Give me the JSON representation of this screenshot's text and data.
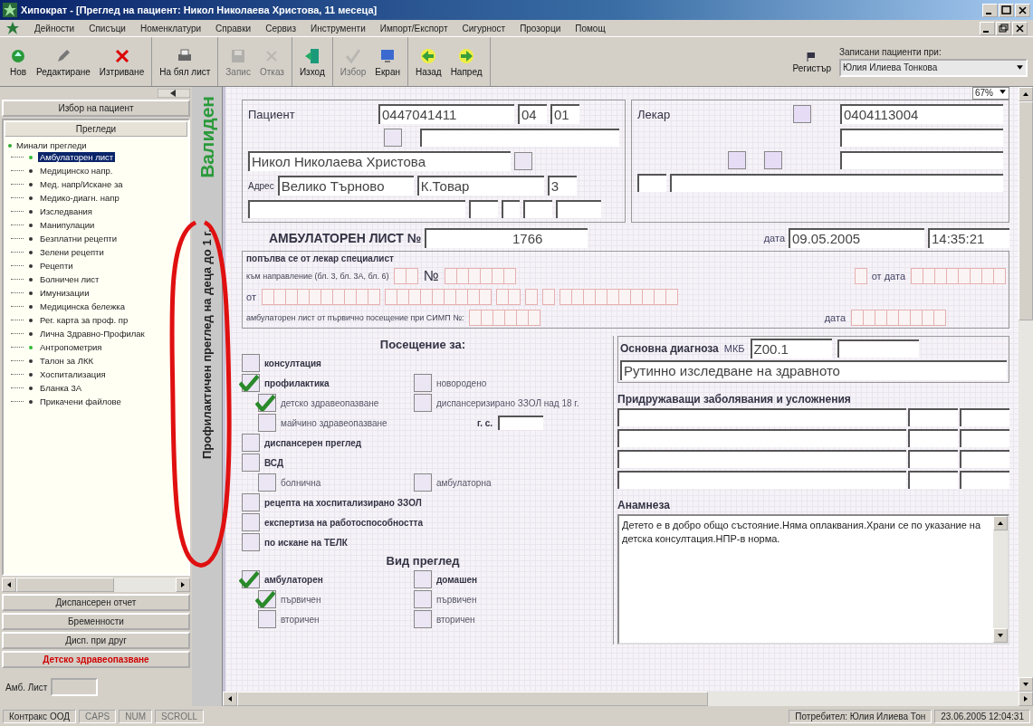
{
  "window": {
    "title": "Хипократ - [Преглед на пациент: Никол Николаева Христова, 11 месеца]"
  },
  "menu": [
    "Дейности",
    "Списъци",
    "Номенклатури",
    "Справки",
    "Сервиз",
    "Инструменти",
    "Импорт/Експорт",
    "Сигурност",
    "Прозорци",
    "Помощ"
  ],
  "toolbar": {
    "groups": [
      {
        "buttons": [
          {
            "label": "Нов",
            "disabled": false
          },
          {
            "label": "Редактиране",
            "disabled": false
          },
          {
            "label": "Изтриване",
            "disabled": false
          }
        ]
      },
      {
        "buttons": [
          {
            "label": "На бял лист",
            "disabled": false
          }
        ]
      },
      {
        "buttons": [
          {
            "label": "Запис",
            "disabled": true
          },
          {
            "label": "Отказ",
            "disabled": true
          }
        ]
      },
      {
        "buttons": [
          {
            "label": "Изход",
            "disabled": false
          }
        ]
      },
      {
        "buttons": [
          {
            "label": "Избор",
            "disabled": true
          },
          {
            "label": "Екран",
            "disabled": false
          }
        ]
      },
      {
        "buttons": [
          {
            "label": "Назад",
            "disabled": false
          },
          {
            "label": "Напред",
            "disabled": false
          }
        ]
      }
    ],
    "register": "Регистър",
    "patients_label": "Записани пациенти при:",
    "patients_value": "Юлия Илиева Тонкова"
  },
  "sidebar": {
    "patient_button": "Избор на пациент",
    "section": "Прегледи",
    "tree": [
      {
        "label": "Минали прегледи",
        "expanded": true,
        "children": [
          {
            "label": "Амбулаторен лист",
            "selected": true,
            "marked": true
          },
          {
            "label": "Медицинско напр.",
            "selected": false,
            "marked": false
          },
          {
            "label": "Мед. напр/Искане за",
            "selected": false,
            "marked": false
          },
          {
            "label": "Медико-диагн. напр",
            "selected": false,
            "marked": false
          },
          {
            "label": "Изследвания",
            "selected": false,
            "marked": false
          },
          {
            "label": "Манипулации",
            "selected": false,
            "marked": false
          },
          {
            "label": "Безплатни рецепти",
            "selected": false,
            "marked": false
          },
          {
            "label": "Зелени рецепти",
            "selected": false,
            "marked": false
          },
          {
            "label": "Рецепти",
            "selected": false,
            "marked": false
          },
          {
            "label": "Болничен лист",
            "selected": false,
            "marked": false
          },
          {
            "label": "Имунизации",
            "selected": false,
            "marked": false
          },
          {
            "label": "Медицинска бележка",
            "selected": false,
            "marked": false
          },
          {
            "label": "Рег. карта за проф. пр",
            "selected": false,
            "marked": false
          },
          {
            "label": "Лична Здравно-Профилак",
            "selected": false,
            "marked": false
          },
          {
            "label": "Антропометрия",
            "selected": false,
            "marked": true
          },
          {
            "label": "Талон за ЛКК",
            "selected": false,
            "marked": false
          },
          {
            "label": "Хоспитализация",
            "selected": false,
            "marked": false
          },
          {
            "label": "Бланка 3А",
            "selected": false,
            "marked": false
          },
          {
            "label": "Прикачени файлове",
            "selected": false,
            "marked": false
          }
        ]
      }
    ],
    "buttons": [
      {
        "label": "Диспансерен отчет",
        "selected": false
      },
      {
        "label": "Бременности",
        "selected": false
      },
      {
        "label": "Дисп. при друг",
        "selected": false
      },
      {
        "label": "Детско здравеопазване",
        "selected": true
      }
    ],
    "amb_label": "Амб. Лист"
  },
  "side_tab": {
    "status": "Валиден",
    "title": "Профилактичен преглед на деца до 1 г."
  },
  "form": {
    "zoom": "67%",
    "patient": {
      "label": "Пациент",
      "egn": "0447041411",
      "rzok": "04",
      "zone": "01",
      "name": "Никол Николаева Христова",
      "address_label": "Адрес",
      "city": "Велико Търново",
      "street": "К.Товар",
      "number": "3",
      "checks": [
        {
          "checked": false
        },
        {
          "checked": false
        }
      ]
    },
    "doctor": {
      "label": "Лекар",
      "uin": "0404113004",
      "checks": [
        {
          "checked": false
        },
        {
          "checked": false
        },
        {
          "checked": false
        }
      ]
    },
    "sheet": {
      "title": "АМБУЛАТОРЕН ЛИСТ №",
      "number": "1766",
      "date_label": "дата",
      "date": "09.05.2005",
      "time": "14:35:21"
    },
    "referral": {
      "title": "попълва се от лекар специалист",
      "line1": "към направление (бл. 3, бл. 3А, бл. 6)",
      "no": "№",
      "from_date": "от дата",
      "from": "от",
      "simp": "амбулаторен лист от първично посещение при СИМП №:",
      "date": "дата"
    },
    "visit": {
      "title": "Посещение за:",
      "rows": [
        {
          "items": [
            {
              "kind": "main",
              "label": "консултация",
              "checked": false
            }
          ]
        },
        {
          "items": [
            {
              "kind": "main",
              "label": "профилактика",
              "checked": true
            },
            {
              "kind": "sub",
              "label": "новородено",
              "checked": false
            }
          ]
        },
        {
          "items": [
            {
              "kind": "sub",
              "label": "детско здравеопазване",
              "checked": true
            },
            {
              "kind": "sub",
              "label": "диспансеризирано ЗЗОЛ над 18 г.",
              "checked": false
            }
          ]
        },
        {
          "items": [
            {
              "kind": "sub",
              "label": "майчино здравеопазване",
              "checked": false
            },
            {
              "kind": "field",
              "label": "г. с."
            }
          ]
        },
        {
          "items": [
            {
              "kind": "main",
              "label": "диспансерен преглед",
              "checked": false
            }
          ]
        },
        {
          "items": [
            {
              "kind": "main",
              "label": "ВСД",
              "checked": false
            }
          ]
        },
        {
          "items": [
            {
              "kind": "sub",
              "label": "болнична",
              "checked": false
            },
            {
              "kind": "sub",
              "label": "амбулаторна",
              "checked": false
            }
          ]
        },
        {
          "items": [
            {
              "kind": "main",
              "label": "рецепта на хоспитализирано ЗЗОЛ",
              "checked": false
            }
          ]
        },
        {
          "items": [
            {
              "kind": "main",
              "label": "експертиза на работоспособността",
              "checked": false
            }
          ]
        },
        {
          "items": [
            {
              "kind": "main",
              "label": "по искане на ТЕЛК",
              "checked": false
            }
          ]
        }
      ]
    },
    "exam_type": {
      "title": "Вид преглед",
      "rows": [
        {
          "items": [
            {
              "kind": "main",
              "label": "амбулаторен",
              "checked": true
            },
            {
              "kind": "main",
              "label": "домашен",
              "checked": false
            }
          ]
        },
        {
          "items": [
            {
              "kind": "sub",
              "label": "първичен",
              "checked": true
            },
            {
              "kind": "sub",
              "label": "първичен",
              "checked": false
            }
          ]
        },
        {
          "items": [
            {
              "kind": "sub",
              "label": "вторичен",
              "checked": false
            },
            {
              "kind": "sub",
              "label": "вторичен",
              "checked": false
            }
          ]
        }
      ]
    },
    "diagnosis": {
      "title": "Основна диагноза",
      "mkb_label": "МКБ",
      "mkb": "Z00.1",
      "text": "Рутинно изследване на здравното"
    },
    "accompanying": {
      "title": "Придружаващи заболявания и усложнения"
    },
    "anamnesis": {
      "title": "Анамнеза",
      "text": "Детето е в добро общо състояние.Няма оплаквания.Храни се по указание на детска консултация.НПР-в норма."
    }
  },
  "status_bar": {
    "company": "Контракс ООД",
    "keys": [
      {
        "label": "CAPS",
        "on": false
      },
      {
        "label": "NUM",
        "on": false
      },
      {
        "label": "SCROLL",
        "on": false
      }
    ],
    "user": "Потребител: Юлия Илиева Тон",
    "datetime": "23.06.2005 12:04:31"
  }
}
